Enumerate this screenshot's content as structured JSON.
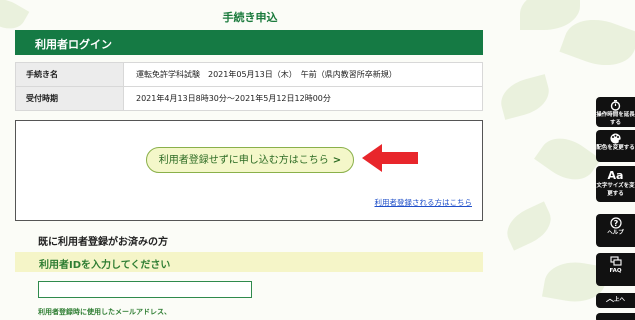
{
  "page": {
    "title": "手続き申込"
  },
  "login_section": {
    "title": "利用者ログイン"
  },
  "info_table": [
    {
      "label": "手続き名",
      "value": "運転免許学科試験　2021年05月13日（木）　午前（県内教習所卒新規）"
    },
    {
      "label": "受付時期",
      "value": "2021年4月13日8時30分～2021年5月12日12時00分"
    }
  ],
  "choice": {
    "register_button_label": "利用者登録せずに申し込む方はこちら",
    "register_button_chevron": ">",
    "registered_link": "利用者登録される方はこちら",
    "arrow_color": "#e8262b"
  },
  "registered": {
    "heading": "既に利用者登録がお済みの方",
    "id_bar_label": "利用者IDを入力してください",
    "id_value": "",
    "note": "利用者登録時に使用したメールアドレス、"
  },
  "side_panel": {
    "items": [
      {
        "icon": "timer-icon",
        "label": "操作時間を延長する"
      },
      {
        "icon": "palette-icon",
        "label": "配色を変更する"
      },
      {
        "icon": "font-size-icon",
        "glyph": "Aa",
        "label": "文字サイズを変更する"
      },
      {
        "icon": "help-icon",
        "label": "ヘルプ"
      },
      {
        "icon": "faq-icon",
        "label": "FAQ"
      },
      {
        "icon": "chevron-up-icon",
        "label": "上へ"
      }
    ]
  },
  "colors": {
    "brand_green": "#157a44",
    "highlight_yellow": "#f5f5c8",
    "link_blue": "#1f4fc9"
  }
}
